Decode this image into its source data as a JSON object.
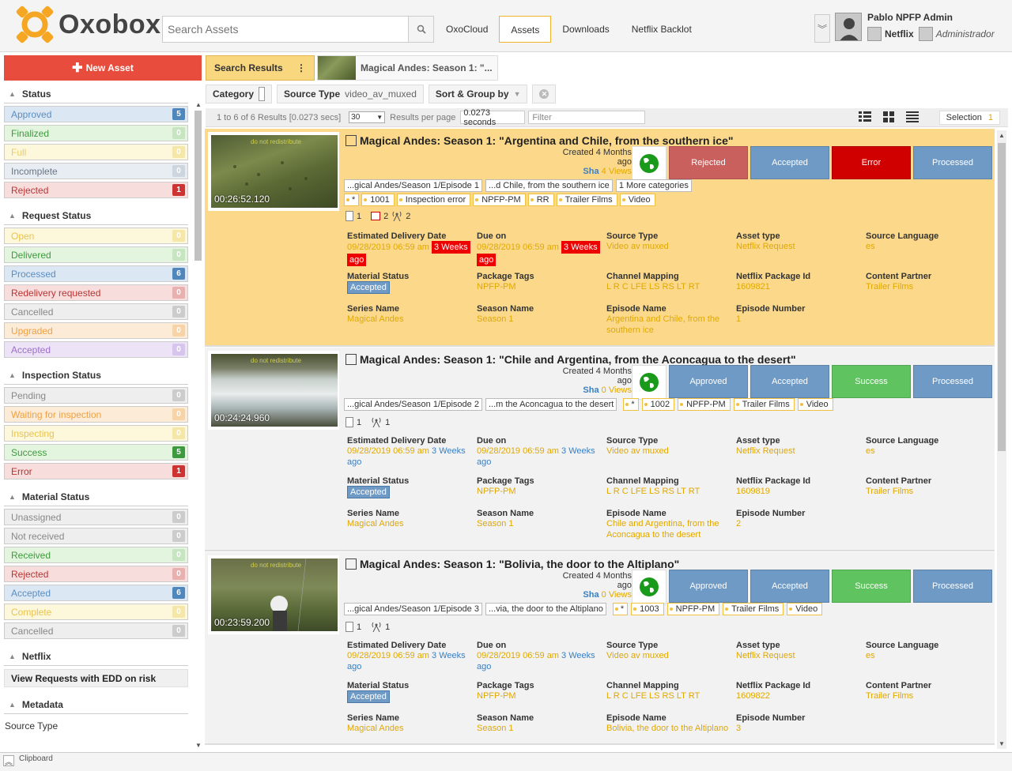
{
  "app": {
    "name": "Oxobox",
    "accent": "#f0b429",
    "brand_orange": "#f5a623"
  },
  "header": {
    "search_placeholder": "Search Assets",
    "tabs": [
      {
        "label": "OxoCloud"
      },
      {
        "label": "Assets"
      },
      {
        "label": "Downloads"
      },
      {
        "label": "Netflix Backlot"
      }
    ],
    "user": {
      "name": "Pablo NPFP Admin",
      "org": "Netflix",
      "role": "Administrador"
    }
  },
  "sidebar": {
    "new_asset": "New Asset",
    "sections": [
      {
        "title": "Status",
        "items": [
          {
            "label": "Approved",
            "count": "5"
          },
          {
            "label": "Finalized",
            "count": "0"
          },
          {
            "label": "Full",
            "count": "0"
          },
          {
            "label": "Incomplete",
            "count": "0"
          },
          {
            "label": "Rejected",
            "count": "1"
          }
        ]
      },
      {
        "title": "Request Status",
        "items": [
          {
            "label": "Open",
            "count": "0"
          },
          {
            "label": "Delivered",
            "count": "0"
          },
          {
            "label": "Processed",
            "count": "6"
          },
          {
            "label": "Redelivery requested",
            "count": "0"
          },
          {
            "label": "Cancelled",
            "count": "0"
          },
          {
            "label": "Upgraded",
            "count": "0"
          },
          {
            "label": "Accepted",
            "count": "0"
          }
        ]
      },
      {
        "title": "Inspection Status",
        "items": [
          {
            "label": "Pending",
            "count": "0"
          },
          {
            "label": "Waiting for inspection",
            "count": "0"
          },
          {
            "label": "Inspecting",
            "count": "0"
          },
          {
            "label": "Success",
            "count": "5"
          },
          {
            "label": "Error",
            "count": "1"
          }
        ]
      },
      {
        "title": "Material Status",
        "items": [
          {
            "label": "Unassigned",
            "count": "0"
          },
          {
            "label": "Not received",
            "count": "0"
          },
          {
            "label": "Received",
            "count": "0"
          },
          {
            "label": "Rejected",
            "count": "0"
          },
          {
            "label": "Accepted",
            "count": "6"
          },
          {
            "label": "Complete",
            "count": "0"
          },
          {
            "label": "Cancelled",
            "count": "0"
          }
        ]
      },
      {
        "title": "Netflix",
        "link": "View Requests with EDD on risk"
      },
      {
        "title": "Metadata",
        "sub": "Source Type"
      }
    ]
  },
  "breadcrumb": {
    "search_results": "Search Results",
    "current": "Magical Andes: Season 1: \"..."
  },
  "filters": {
    "category": "Category",
    "source_type_label": "Source Type",
    "source_type_value": "video_av_muxed",
    "sort_group": "Sort & Group by"
  },
  "results": {
    "count_text": "1 to 6 of 6 Results [0.0273 secs]",
    "per_page": "30",
    "per_page_label": "Results per page",
    "seconds": "0.0273 seconds",
    "filter_placeholder": "Filter",
    "selection_label": "Selection",
    "selection_count": "1"
  },
  "labels": {
    "edd": "Estimated Delivery Date",
    "due": "Due on",
    "source_type": "Source Type",
    "asset_type": "Asset type",
    "source_lang": "Source Language",
    "material_status": "Material Status",
    "package_tags": "Package Tags",
    "channel_mapping": "Channel Mapping",
    "pkg_id": "Netflix Package Id",
    "partner": "Content Partner",
    "series": "Series Name",
    "season": "Season Name",
    "episode": "Episode Name",
    "ep_num": "Episode Number",
    "created": "Created 4 Months ago",
    "sha": "Sha"
  },
  "assets": [
    {
      "title": "Magical Andes: Season 1: \"Argentina and Chile, from the southern ice\"",
      "timecode": "00:26:52.120",
      "views": "4 Views",
      "status_buttons": [
        "Rejected",
        "Accepted",
        "Error",
        "Processed"
      ],
      "path_tags": [
        "...gical Andes/Season 1/Episode 1",
        "...d Chile, from the southern ice",
        "1 More categories"
      ],
      "tags": [
        "*",
        "1001",
        "Inspection error",
        "NPFP-PM",
        "RR",
        "Trailer Films",
        "Video"
      ],
      "doc_count": "1",
      "comment_count": "2",
      "ant_count": "2",
      "edd": "09/28/2019 06:59 am",
      "edd_rel": "3 Weeks",
      "edd_rel2": "ago",
      "due": "09/28/2019 06:59 am",
      "due_rel": "3 Weeks",
      "due_rel2": "ago",
      "source_type": "Video av muxed",
      "asset_type": "Netflix Request",
      "source_lang": "es",
      "material_status": "Accepted",
      "package_tags": "NPFP-PM",
      "channel_mapping": "L R C LFE LS RS LT RT",
      "pkg_id": "1609821",
      "partner": "Trailer Films",
      "series": "Magical Andes",
      "season": "Season 1",
      "episode": "Argentina and Chile, from the southern ice",
      "ep_num": "1"
    },
    {
      "title": "Magical Andes: Season 1: \"Chile and Argentina, from the Aconcagua to the desert\"",
      "timecode": "00:24:24.960",
      "views": "0 Views",
      "status_buttons": [
        "Approved",
        "Accepted",
        "Success",
        "Processed"
      ],
      "path_tags": [
        "...gical Andes/Season 1/Episode 2",
        "...m the Aconcagua to the desert"
      ],
      "tags": [
        "*",
        "1002",
        "NPFP-PM",
        "Trailer Films",
        "Video"
      ],
      "doc_count": "1",
      "ant_count": "1",
      "edd": "09/28/2019 06:59 am",
      "edd_rel": "3 Weeks",
      "edd_rel2": "ago",
      "due": "09/28/2019 06:59 am",
      "due_rel": "3 Weeks",
      "due_rel2": "ago",
      "source_type": "Video av muxed",
      "asset_type": "Netflix Request",
      "source_lang": "es",
      "material_status": "Accepted",
      "package_tags": "NPFP-PM",
      "channel_mapping": "L R C LFE LS RS LT RT",
      "pkg_id": "1609819",
      "partner": "Trailer Films",
      "series": "Magical Andes",
      "season": "Season 1",
      "episode": "Chile and Argentina, from the Aconcagua to the desert",
      "ep_num": "2"
    },
    {
      "title": "Magical Andes: Season 1: \"Bolivia, the door to the Altiplano\"",
      "timecode": "00:23:59.200",
      "views": "0 Views",
      "status_buttons": [
        "Approved",
        "Accepted",
        "Success",
        "Processed"
      ],
      "path_tags": [
        "...gical Andes/Season 1/Episode 3",
        "...via, the door to the Altiplano"
      ],
      "tags": [
        "*",
        "1003",
        "NPFP-PM",
        "Trailer Films",
        "Video"
      ],
      "doc_count": "1",
      "ant_count": "1",
      "edd": "09/28/2019 06:59 am",
      "edd_rel": "3 Weeks",
      "edd_rel2": "ago",
      "due": "09/28/2019 06:59 am",
      "due_rel": "3 Weeks",
      "due_rel2": "ago",
      "source_type": "Video av muxed",
      "asset_type": "Netflix Request",
      "source_lang": "es",
      "material_status": "Accepted",
      "package_tags": "NPFP-PM",
      "channel_mapping": "L R C LFE LS RS LT RT",
      "pkg_id": "1609822",
      "partner": "Trailer Films",
      "series": "Magical Andes",
      "season": "Season 1",
      "episode": "Bolivia, the door to the Altiplano",
      "ep_num": "3"
    }
  ],
  "footer": {
    "clipboard": "Clipboard"
  }
}
